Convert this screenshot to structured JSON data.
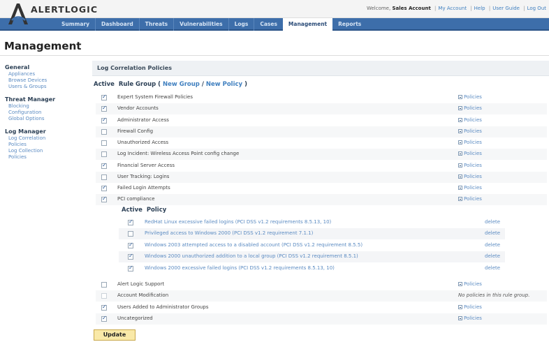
{
  "header": {
    "logo_text": "ALERTLOGIC",
    "welcome_prefix": "Welcome,",
    "account_name": "Sales Account",
    "links": [
      "My Account",
      "Help",
      "User Guide",
      "Log Out"
    ]
  },
  "nav": {
    "items": [
      "Summary",
      "Dashboard",
      "Threats",
      "Vulnerabilities",
      "Logs",
      "Cases",
      "Management",
      "Reports"
    ],
    "active": "Management"
  },
  "page": {
    "title": "Management"
  },
  "sidebar": {
    "groups": [
      {
        "title": "General",
        "links": [
          "Appliances",
          "Browse Devices",
          "Users & Groups"
        ]
      },
      {
        "title": "Threat Manager",
        "links": [
          "Blocking Configuration",
          "Global Options"
        ]
      },
      {
        "title": "Log Manager",
        "links": [
          "Log Correlation Policies",
          "Log Collection Policies"
        ]
      }
    ]
  },
  "main": {
    "section_title": "Log Correlation Policies",
    "col_active": "Active",
    "col_rule_group": "Rule Group (",
    "new_group": "New Group",
    "slash": "/",
    "new_policy": "New Policy",
    "close_paren": ")",
    "policies_link": "Policies",
    "no_policies_note": "No policies in this rule group.",
    "rule_groups_top": [
      {
        "name": "Expert System Firewall Policies",
        "active": true
      },
      {
        "name": "Vendor Accounts",
        "active": true
      },
      {
        "name": "Administrator Access",
        "active": true
      },
      {
        "name": "Firewall Config",
        "active": false
      },
      {
        "name": "Unauthorized Access",
        "active": false
      },
      {
        "name": "Log Incident: Wireless Access Point config change",
        "active": false
      },
      {
        "name": "Financial Server Access",
        "active": true
      },
      {
        "name": "User Tracking: Logins",
        "active": false
      },
      {
        "name": "Failed Login Attempts",
        "active": true
      },
      {
        "name": "PCI compliance",
        "active": true
      }
    ],
    "policy_table": {
      "col_active": "Active",
      "col_policy": "Policy",
      "delete_label": "delete",
      "rows": [
        {
          "name": "RedHat Linux excessive failed logins (PCI DSS v1.2 requirements 8.5.13, 10)",
          "active": true
        },
        {
          "name": "Privileged access to Windows 2000 (PCI DSS v1.2 requirement 7.1.1)",
          "active": false
        },
        {
          "name": "Windows 2003 attempted access to a disabled account (PCI DSS v1.2 requirement 8.5.5)",
          "active": true
        },
        {
          "name": "Windows 2000 unauthorized addition to a local group (PCI DSS v1.2 requirement 8.5.1)",
          "active": true
        },
        {
          "name": "Windows 2000 excessive failed logins (PCI DSS v1.2 requirements 8.5.13, 10)",
          "active": true
        }
      ]
    },
    "rule_groups_bottom": [
      {
        "name": "Alert Logic Support",
        "active": false,
        "has_policies": true
      },
      {
        "name": "Account Modification",
        "active": false,
        "has_policies": false
      },
      {
        "name": "Users Added to Administrator Groups",
        "active": true,
        "has_policies": true
      },
      {
        "name": "Uncategorized",
        "active": true,
        "has_policies": true
      }
    ],
    "update_label": "Update"
  }
}
